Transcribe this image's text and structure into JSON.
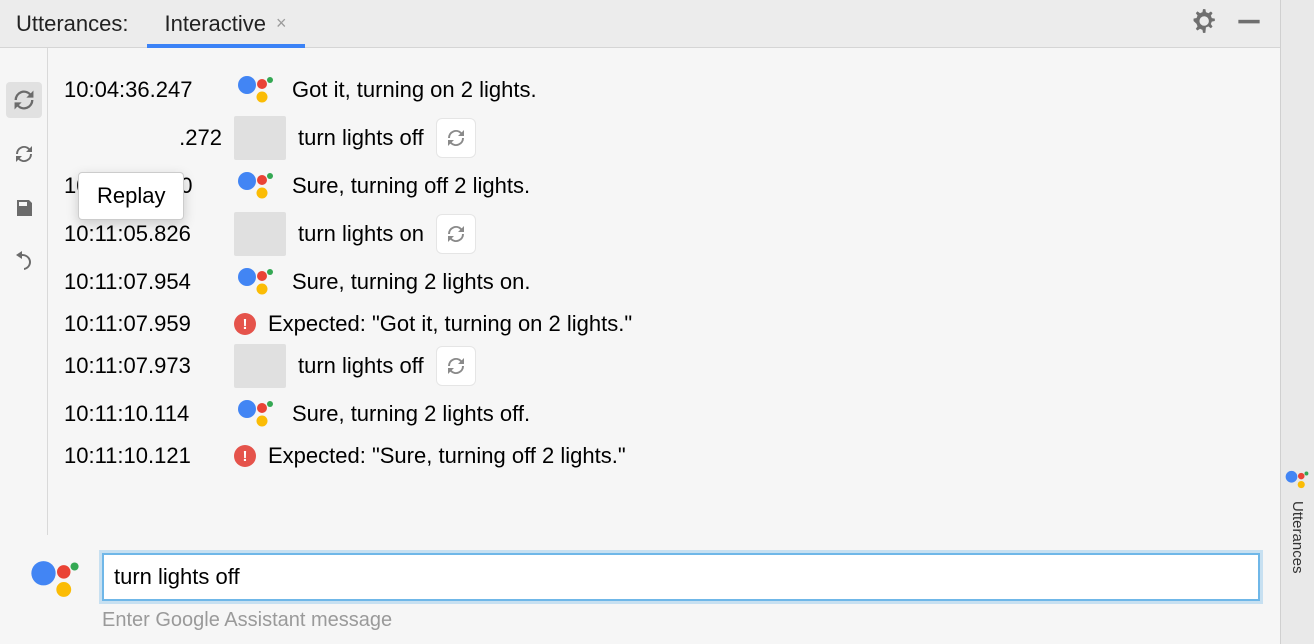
{
  "tabstrip": {
    "title": "Utterances:",
    "active_tab": "Interactive"
  },
  "toolbar": {
    "tooltip": "Replay"
  },
  "side_tab": {
    "label": "Utterances"
  },
  "input": {
    "value": "turn lights off",
    "hint": "Enter Google Assistant message"
  },
  "rows": [
    {
      "ts": "10:04:36.247",
      "kind": "assistant",
      "text": "Got it, turning on 2 lights."
    },
    {
      "ts": ".272",
      "kind": "user",
      "text": "turn lights off"
    },
    {
      "ts": "10:06:55.230",
      "kind": "assistant",
      "text": "Sure, turning off 2 lights."
    },
    {
      "ts": "10:11:05.826",
      "kind": "user",
      "text": "turn lights on"
    },
    {
      "ts": "10:11:07.954",
      "kind": "assistant",
      "text": "Sure, turning 2 lights on."
    },
    {
      "ts": "10:11:07.959",
      "kind": "error",
      "text": "Expected: \"Got it, turning on 2 lights.\""
    },
    {
      "ts": "10:11:07.973",
      "kind": "user",
      "text": "turn lights off"
    },
    {
      "ts": "10:11:10.114",
      "kind": "assistant",
      "text": "Sure, turning 2 lights off."
    },
    {
      "ts": "10:11:10.121",
      "kind": "error",
      "text": "Expected: \"Sure, turning off 2 lights.\""
    }
  ]
}
